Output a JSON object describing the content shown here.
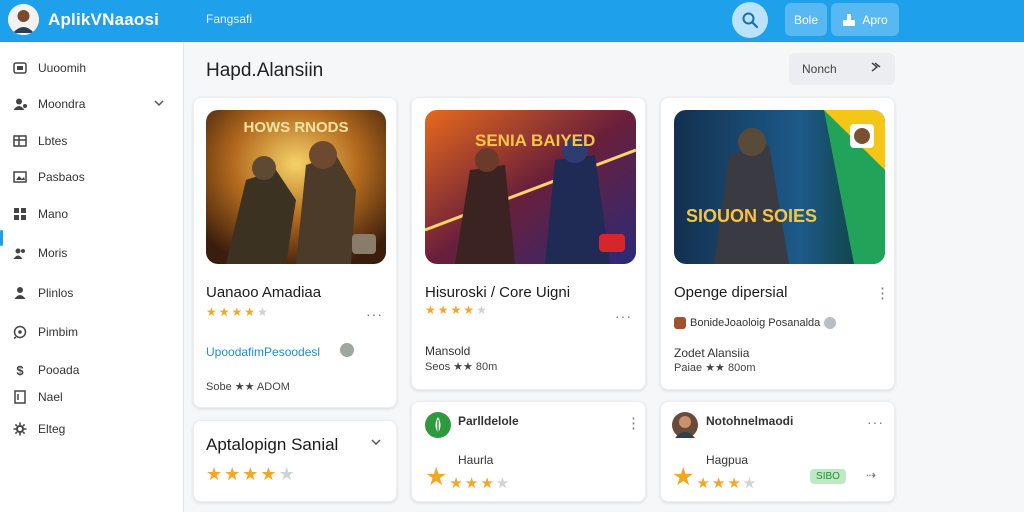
{
  "header": {
    "title": "AplikVNaaosi",
    "nav_link": "Fangsafi",
    "btn_1_label": "Bole",
    "btn_2_label": "Apro",
    "colors": {
      "bar": "#1fa0ea",
      "button": "#58b9f2"
    }
  },
  "sidebar": {
    "items": [
      {
        "label": "Uuoomih",
        "icon": "box-icon"
      },
      {
        "label": "Moondra",
        "icon": "user-icon",
        "expandable": true
      },
      {
        "label": "Lbtes",
        "icon": "grid-icon"
      },
      {
        "label": "Pasbaos",
        "icon": "image-icon"
      },
      {
        "label": "Mano",
        "icon": "apps-icon"
      },
      {
        "label": "Moris",
        "icon": "people-icon",
        "active": true
      },
      {
        "label": "Plinlos",
        "icon": "person-icon"
      },
      {
        "label": "Pimbim",
        "icon": "tag-icon"
      },
      {
        "label": "Pooada",
        "icon": "dollar-icon"
      },
      {
        "label": "Nael",
        "icon": "file-icon"
      },
      {
        "label": "Elteg",
        "icon": "gear-icon"
      }
    ]
  },
  "main": {
    "title": "Hapd.Alansiin",
    "sort_label": "Nonch",
    "cards": [
      {
        "title": "Uanaoo Amadiaa",
        "rating": 4,
        "meta_link": "UpoodafimPesoodesl",
        "small": "Sobe ★★ ADOM",
        "badge": ""
      },
      {
        "title": "Hisuroski / Core Uigni",
        "rating": 4,
        "meta": "Mansold",
        "small": "Seos ★★ 80m",
        "badge": "red-badge"
      },
      {
        "title": "Openge dipersial",
        "rating": 0,
        "meta_brand": "BonideJoaoloig Posanalda",
        "meta": "Zodet Alansiia",
        "small": "Paiae ★★ 80om",
        "badge": ""
      }
    ],
    "bottom_cards": [
      {
        "title": "Aptalopign Sanial",
        "rating": 4
      },
      {
        "title": "Parlldelole",
        "sub": "Haurla",
        "rating": 4
      },
      {
        "title": "Notohnelmaodi",
        "sub": "Hagpua",
        "rating": 4,
        "pill": "SIBO"
      }
    ],
    "thumb_texts": [
      "HOWS RNODS",
      "SENIA BAIYED",
      "SIOUON SOIES"
    ],
    "accent_star_color": "#f5a623"
  }
}
